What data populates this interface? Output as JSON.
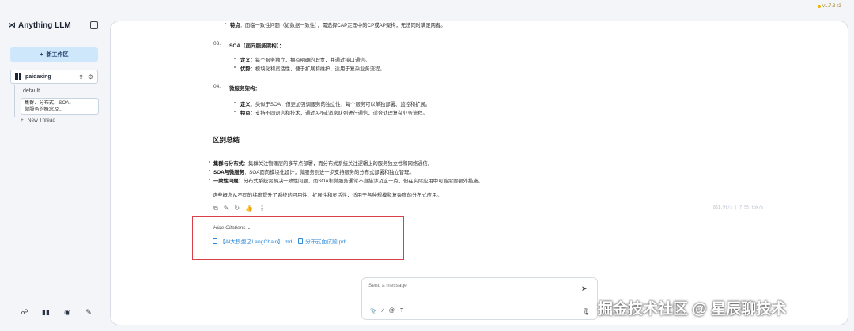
{
  "sidebar": {
    "brand": "Anything LLM",
    "brand_mark": "⋈",
    "new_workspace_label": "新工作区",
    "workspace": {
      "name": "paidaxing"
    },
    "threads": [
      {
        "label": "default"
      },
      {
        "label_line1": "集群、分布式、SOA、",
        "label_line2": "微服务的概念及..."
      }
    ],
    "new_thread_label": "New Thread"
  },
  "version": "v1.7.3-r2",
  "content": {
    "item_top": {
      "term": "特点",
      "text": "：面临一致性问题（如数据一致性），需选择CAP定理中的CP或AP架构，无法同时满足两者。"
    },
    "item3": {
      "num": "03.",
      "title": "SOA（面向服务架构）：",
      "points": [
        {
          "term": "定义",
          "text": "：每个服务独立，拥有明确的职责，并通过接口通信。"
        },
        {
          "term": "优势",
          "text": "：模块化和灵活性，便于扩展和维护，适用于复杂业务流程。"
        }
      ]
    },
    "item4": {
      "num": "04.",
      "title": "微服务架构：",
      "points": [
        {
          "term": "定义",
          "text": "：类似于SOA，但更加强调服务的独立性，每个服务可以单独部署、监控和扩展。"
        },
        {
          "term": "特点",
          "text": "：支持不同语言和技术，通过API或消息队列进行通信，适合处理复杂业务流程。"
        }
      ]
    },
    "summary_title": "区别总结",
    "summary": [
      {
        "term": "集群与分布式",
        "text": "：集群关注物理层的多节点部署，而分布式系统关注逻辑上的服务独立性和网络通信。"
      },
      {
        "term": "SOA与微服务",
        "text": "：SOA面向模块化设计，微服务则进一步支持服务的分布式部署和独立管理。"
      },
      {
        "term": "一致性问题",
        "text": "：分布式系统需解决一致性问题，而SOA和微服务通常不直接涉及这一点，但在实际应用中可能需要额外措施。"
      }
    ],
    "conclusion": "这些概念从不同的纬度提升了系统的可用性、扩展性和灵活性，适用于各种规模和复杂度的分布式应用。",
    "meta": "861.9t/s | 7.55 tok/s"
  },
  "citations": {
    "toggle_label": "Hide Citations",
    "files": [
      {
        "name": "【AI大模型之LangChain】.md"
      },
      {
        "name": "分布式面试题.pdf"
      }
    ]
  },
  "prompt": {
    "placeholder": "Send a message"
  },
  "watermark": "掘金技术社区 @ 星辰聊技术"
}
